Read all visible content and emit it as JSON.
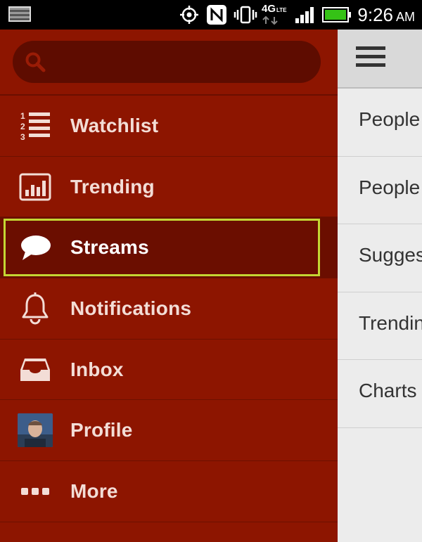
{
  "status_bar": {
    "time": "9:26",
    "ampm": "AM",
    "network": "4G",
    "network_sub": "LTE",
    "icons": [
      "screenshot-thumbnail-icon",
      "gps-icon",
      "nfc-icon",
      "vibrate-icon",
      "network-4g-icon",
      "signal-icon",
      "battery-icon"
    ]
  },
  "search": {
    "placeholder": "",
    "value": ""
  },
  "menu": {
    "items": [
      {
        "label": "Watchlist",
        "icon": "numbered-list-icon"
      },
      {
        "label": "Trending",
        "icon": "bar-chart-icon"
      },
      {
        "label": "Streams",
        "icon": "speech-bubble-icon",
        "selected": true
      },
      {
        "label": "Notifications",
        "icon": "bell-icon"
      },
      {
        "label": "Inbox",
        "icon": "inbox-tray-icon"
      },
      {
        "label": "Profile",
        "icon": "avatar"
      },
      {
        "label": "More",
        "icon": "ellipsis-icon"
      }
    ]
  },
  "content": {
    "items": [
      "People",
      "People",
      "Sugges",
      "Trendin",
      "Charts"
    ]
  },
  "colors": {
    "drawer_bg": "#8d1500",
    "selected_bg": "#6b0e00",
    "selected_outline": "#c4d633",
    "search_bg": "#5e0c00",
    "content_bg": "#ececec"
  }
}
